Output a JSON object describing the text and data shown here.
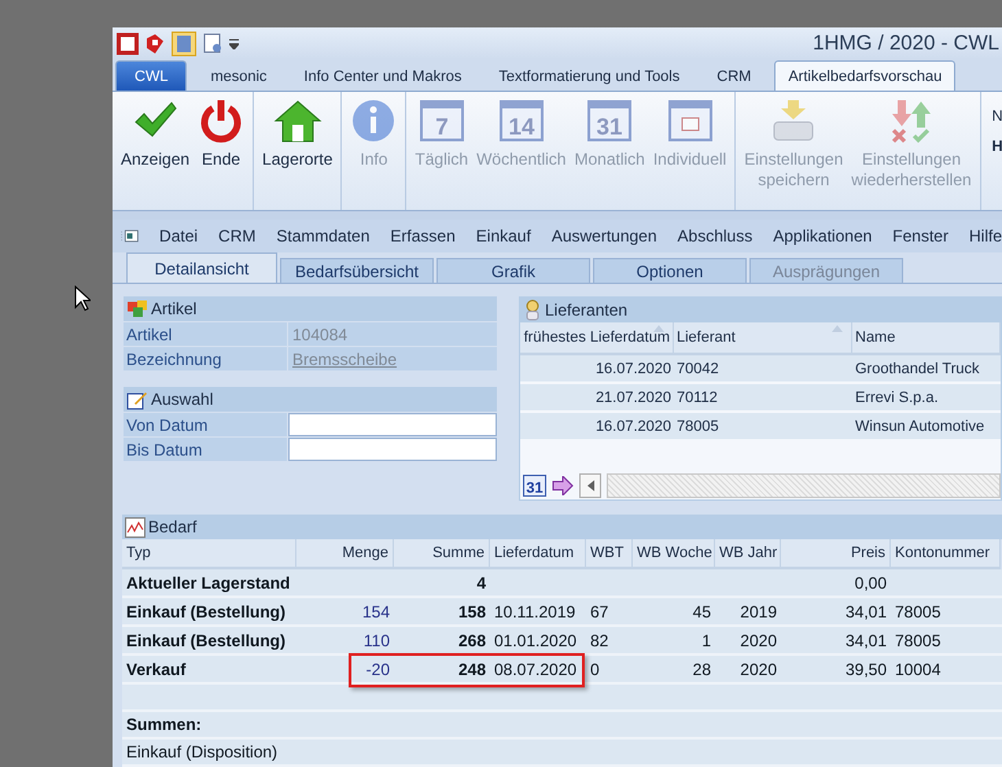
{
  "window": {
    "title": "1HMG / 2020 - CWL"
  },
  "ribbon_tabs": [
    {
      "label": "CWL",
      "kind": "app",
      "selected": false
    },
    {
      "label": "mesonic",
      "kind": "tab",
      "selected": false
    },
    {
      "label": "Info Center und Makros",
      "kind": "tab",
      "selected": false
    },
    {
      "label": "Textformatierung und Tools",
      "kind": "tab",
      "selected": false
    },
    {
      "label": "CRM",
      "kind": "tab",
      "selected": false
    },
    {
      "label": "Artikelbedarfsvorschau",
      "kind": "tab",
      "selected": true
    }
  ],
  "ribbon_groups": [
    {
      "items": [
        {
          "label": "Anzeigen",
          "kind": "check",
          "disabled": false
        },
        {
          "label": "Ende",
          "kind": "power",
          "disabled": false
        }
      ]
    },
    {
      "items": [
        {
          "label": "Lagerorte",
          "kind": "home",
          "disabled": false
        }
      ]
    },
    {
      "items": [
        {
          "label": "Info",
          "kind": "info",
          "disabled": true
        }
      ]
    },
    {
      "items": [
        {
          "label": "Täglich",
          "kind": "calendar",
          "icon_text": "7",
          "disabled": true
        },
        {
          "label": "Wöchentlich",
          "kind": "calendar",
          "icon_text": "14",
          "disabled": true
        },
        {
          "label": "Monatlich",
          "kind": "calendar",
          "icon_text": "31",
          "disabled": true
        },
        {
          "label": "Individuell",
          "kind": "calendar",
          "disabled": true
        }
      ]
    },
    {
      "items": [
        {
          "label": "Einstellungen speichern",
          "kind": "save",
          "disabled": true
        },
        {
          "label": "Einstellungen wiederherstellen",
          "kind": "restore",
          "disabled": true
        }
      ]
    }
  ],
  "ribbon_partial_group": {
    "line_1": "N",
    "line_2": "H"
  },
  "menu": [
    "Datei",
    "CRM",
    "Stammdaten",
    "Erfassen",
    "Einkauf",
    "Auswertungen",
    "Abschluss",
    "Applikationen",
    "Fenster",
    "Hilfe"
  ],
  "view_tabs": [
    {
      "label": "Detailansicht",
      "selected": true,
      "disabled": false
    },
    {
      "label": "Bedarfsübersicht",
      "selected": false,
      "disabled": false
    },
    {
      "label": "Grafik",
      "selected": false,
      "disabled": false
    },
    {
      "label": "Optionen",
      "selected": false,
      "disabled": false
    },
    {
      "label": "Ausprägungen",
      "selected": false,
      "disabled": true
    }
  ],
  "artikel": {
    "title": "Artikel",
    "fields": [
      {
        "label": "Artikel",
        "value": "104084",
        "link": false
      },
      {
        "label": "Bezeichnung",
        "value": "Bremsscheibe",
        "link": true
      }
    ]
  },
  "auswahl": {
    "title": "Auswahl",
    "fields": [
      {
        "label": "Von Datum"
      },
      {
        "label": "Bis Datum"
      }
    ]
  },
  "lieferanten": {
    "title": "Lieferanten",
    "columns": [
      "frühestes Lieferdatum",
      "Lieferant",
      "Name"
    ],
    "rows": [
      [
        "16.07.2020",
        "70042",
        "Groothandel Truck"
      ],
      [
        "21.07.2020",
        "70112",
        "Errevi S.p.a."
      ],
      [
        "16.07.2020",
        "78005",
        "Winsun Automotive"
      ]
    ],
    "footer_icon_text": "31"
  },
  "bedarf": {
    "title": "Bedarf",
    "columns": [
      "Typ",
      "Menge",
      "Summe",
      "Lieferdatum",
      "WBT",
      "WB Woche",
      "WB Jahr",
      "Preis",
      "Kontonummer"
    ],
    "rows": [
      {
        "cells": [
          "Aktueller Lagerstand",
          "",
          "4",
          "",
          "",
          "",
          "",
          "0,00",
          ""
        ],
        "highlighted": false
      },
      {
        "cells": [
          "Einkauf (Bestellung)",
          "154",
          "158",
          "10.11.2019",
          "67",
          "45",
          "2019",
          "34,01",
          "78005"
        ],
        "highlighted": false
      },
      {
        "cells": [
          "Einkauf (Bestellung)",
          "110",
          "268",
          "01.01.2020",
          "82",
          "1",
          "2020",
          "34,01",
          "78005"
        ],
        "highlighted": false
      },
      {
        "cells": [
          "Verkauf",
          "-20",
          "248",
          "08.07.2020",
          "0",
          "28",
          "2020",
          "39,50",
          "10004"
        ],
        "highlighted": true
      }
    ],
    "totals_title": "Summen:",
    "totals": [
      "Einkauf (Disposition)"
    ]
  }
}
